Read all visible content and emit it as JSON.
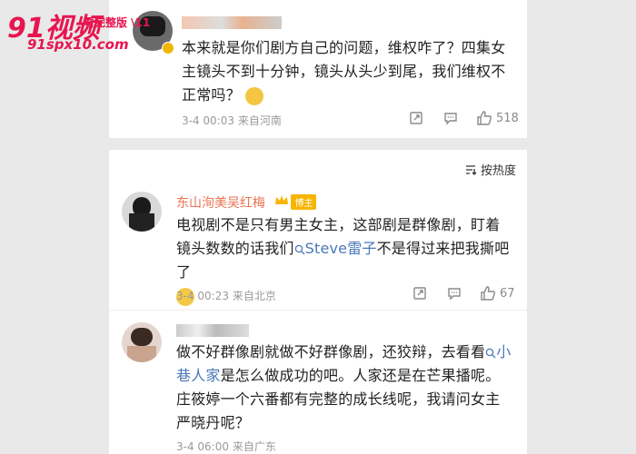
{
  "watermark": {
    "logo": "91视频",
    "tag": "看完整版 \\11",
    "url": "91spx10.com"
  },
  "comments": [
    {
      "username": "",
      "text": "本来就是你们剧方自己的问题，维权咋了？四集女主镜头不到十分钟，镜头从头少到尾，我们维权不正常吗？",
      "emoji": "smile-emoji",
      "time": "3-4 00:03",
      "location": "来自河南",
      "likes": "518"
    },
    {
      "username": "东山洵美吴红梅",
      "badge_label": "博主",
      "text_before": "电视剧不是只有男主女主，这部剧是群像剧，盯着镜头数数的话我们",
      "mention": "Steve雷子",
      "text_after": "不是得过来把我撕吧了",
      "emoji": "crying-emoji",
      "time": "3-4 00:23",
      "location": "来自北京",
      "likes": "67"
    },
    {
      "username": "",
      "text_before": "做不好群像剧就做不好群像剧，还狡辩，去看看",
      "mention": "小巷人家",
      "text_after": "是怎么做成功的吧。人家还是在芒果播呢。庄筱婷一个六番都有完整的成长线呢，我请问女主严晓丹呢？",
      "time": "3-4 06:00",
      "location": "来自广东"
    }
  ],
  "sort_label": "按热度",
  "colors": {
    "link": "#4a78b8",
    "username": "#eb7350",
    "watermark": "#e8154f",
    "badge": "#f7b500"
  }
}
